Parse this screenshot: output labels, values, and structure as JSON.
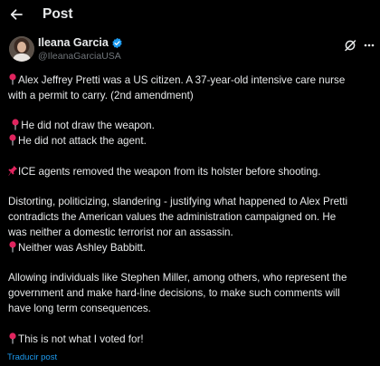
{
  "header": {
    "title": "Post"
  },
  "author": {
    "display_name": "Ileana Garcia",
    "handle": "@IleanaGarciaUSA"
  },
  "icons": {
    "back": "arrow-left-icon",
    "verified": "verified-badge-icon",
    "grok": "grok-icon",
    "more": "more-icon",
    "pin": "round-pushpin-emoji",
    "pushpin": "pushpin-emoji"
  },
  "post": {
    "p1_l1": "Alex Jeffrey Pretti was a US citizen. A 37-year-old intensive care nurse",
    "p1_l2": "with a permit to carry. (2nd amendment)",
    "p2_l1": "He did not draw the weapon.",
    "p2_l2": "He did not attack the agent.",
    "p3_l1": "ICE agents removed the weapon from its holster before shooting.",
    "p4_l1": "Distorting, politicizing, slandering - justifying what happened to Alex Pretti",
    "p4_l2": "contradicts the American values the administration campaigned on.  He",
    "p4_l3": "was neither a domestic terrorist nor an assassin.",
    "p4_l4": "Neither was Ashley Babbitt.",
    "p5_l1": "Allowing individuals like Stephen Miller, among others, who represent the",
    "p5_l2": "government and make hard-line decisions, to make such comments will",
    "p5_l3": "have long term consequences.",
    "p6_l1": "This is not what I voted for!"
  },
  "footer": {
    "translate_label": "Traducir post"
  },
  "colors": {
    "background": "#000000",
    "text": "#e7e9ea",
    "muted": "#71767b",
    "link": "#1d9bf0",
    "pin_red": "#e0245e"
  }
}
